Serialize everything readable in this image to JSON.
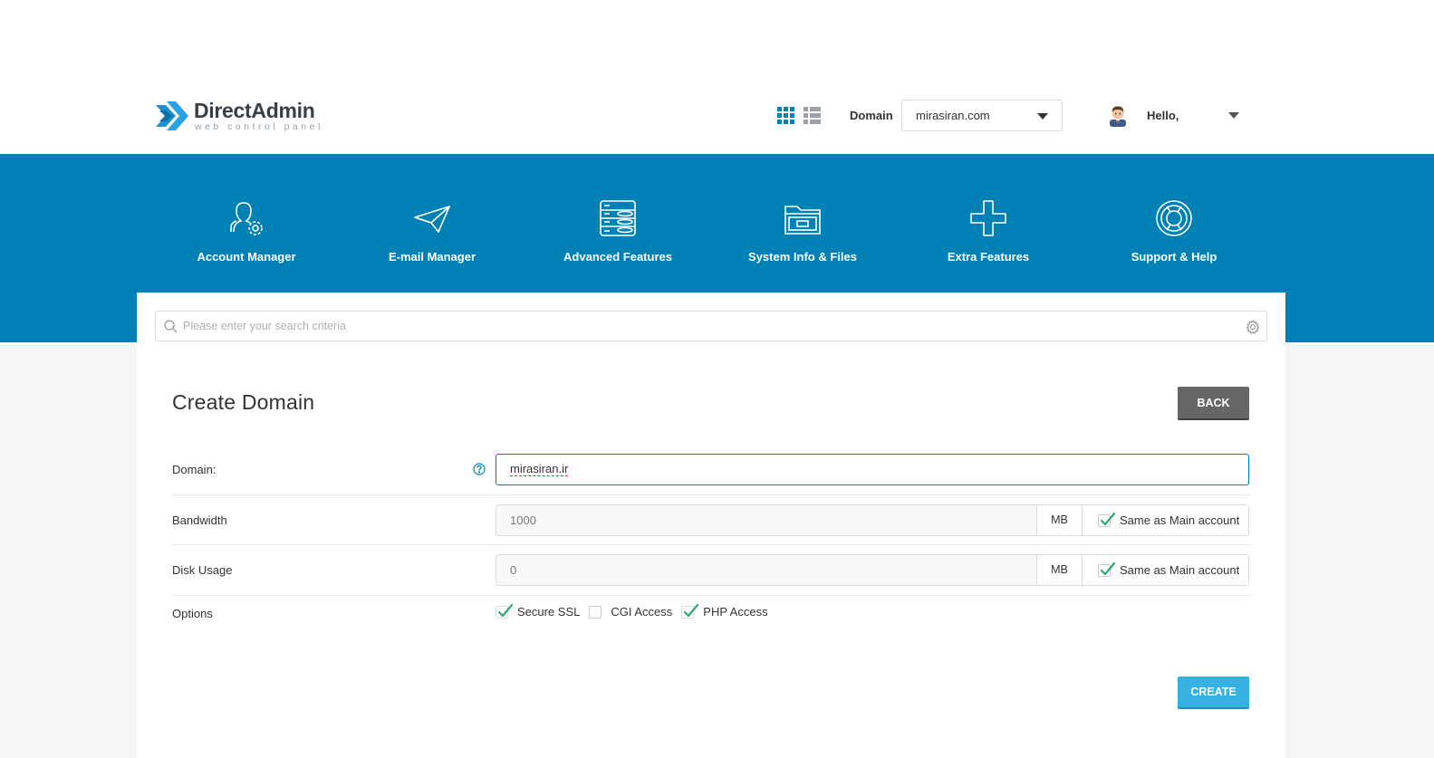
{
  "brand": {
    "name": "DirectAdmin",
    "tagline": "web control panel"
  },
  "header": {
    "domain_label": "Domain",
    "domain_selected": "mirasiran.com",
    "greeting": "Hello,"
  },
  "nav": [
    {
      "label": "Account Manager",
      "icon": "account-manager-icon"
    },
    {
      "label": "E-mail Manager",
      "icon": "paper-plane-icon"
    },
    {
      "label": "Advanced Features",
      "icon": "server-stack-icon"
    },
    {
      "label": "System Info & Files",
      "icon": "folder-icon"
    },
    {
      "label": "Extra Features",
      "icon": "plus-icon"
    },
    {
      "label": "Support & Help",
      "icon": "lifebuoy-icon"
    }
  ],
  "search": {
    "placeholder": "Please enter your search criteria"
  },
  "page": {
    "title": "Create Domain",
    "back_label": "BACK",
    "create_label": "CREATE"
  },
  "form": {
    "domain": {
      "label": "Domain:",
      "value": "mirasiran.ir"
    },
    "bandwidth": {
      "label": "Bandwidth",
      "value": "1000",
      "unit": "MB",
      "same_label": "Same as Main account",
      "same_checked": true
    },
    "disk": {
      "label": "Disk Usage",
      "value": "0",
      "unit": "MB",
      "same_label": "Same as Main account",
      "same_checked": true
    },
    "options": {
      "label": "Options",
      "items": [
        {
          "label": "Secure SSL",
          "checked": true
        },
        {
          "label": "CGI Access",
          "checked": false
        },
        {
          "label": "PHP Access",
          "checked": true
        }
      ]
    }
  },
  "colors": {
    "brand_blue": "#0081b5",
    "check_green": "#2eaa6e",
    "create_button": "#36b2e2",
    "back_button": "#666666"
  }
}
